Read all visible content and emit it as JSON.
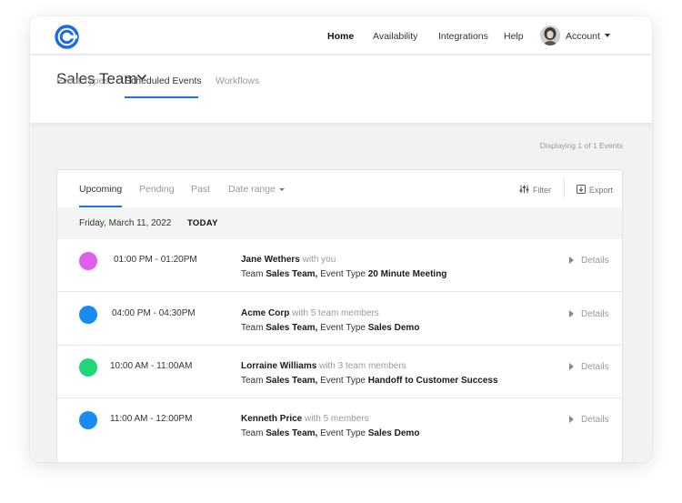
{
  "nav": {
    "logo_icon": "calendly-logo-icon",
    "links": [
      "Home",
      "Availability",
      "Integrations",
      "Help"
    ],
    "active": "Home",
    "account_label": "Account"
  },
  "header": {
    "team_name": "Sales Team",
    "tabs": [
      "Event Types",
      "Scheduled Events",
      "Workflows"
    ],
    "active_tab": "Scheduled Events"
  },
  "display_count": "Displaying 1 of 1 Events",
  "panel": {
    "filters": [
      "Upcoming",
      "Pending",
      "Past",
      "Date range"
    ],
    "active_filter": "Upcoming",
    "filter_label": "Filter",
    "export_label": "Export",
    "date": "Friday, March 11, 2022",
    "today_label": "TODAY",
    "details_label": "Details",
    "team_prefix": "Team",
    "event_type_prefix": "Event Type",
    "events": [
      {
        "color": "#e05ef0",
        "time": "01:00 PM - 01:20PM",
        "name": "Jane Wethers",
        "with": "with you",
        "team": "Sales Team,",
        "event_type": "20 Minute Meeting"
      },
      {
        "color": "#1a8cf0",
        "time": "04:00 PM - 04:30PM",
        "name": "Acme Corp",
        "with": "with 5 team members",
        "team": "Sales Team,",
        "event_type": "Sales Demo"
      },
      {
        "color": "#1fd67a",
        "time": "10:00 AM - 11:00AM",
        "name": "Lorraine Williams",
        "with": "with 3 team members",
        "team": "Sales Team,",
        "event_type": "Handoff to Customer Success"
      },
      {
        "color": "#1a8cf0",
        "time": "11:00 AM - 12:00PM",
        "name": "Kenneth Price",
        "with": "with 5 members",
        "team": "Sales Team,",
        "event_type": "Sales Demo"
      }
    ]
  }
}
